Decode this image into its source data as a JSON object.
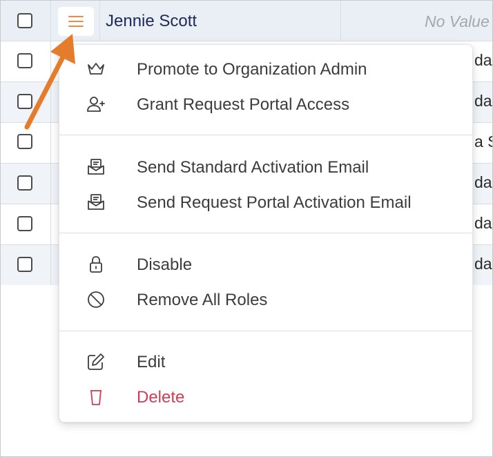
{
  "table": {
    "header_row": {
      "name": "Jennie Scott",
      "value": "No Value"
    },
    "rows": [
      {
        "role_fragment": "da"
      },
      {
        "role_fragment": "dar"
      },
      {
        "role_fragment": "a S"
      },
      {
        "role_fragment": "da"
      },
      {
        "role_fragment": "da"
      },
      {
        "role_fragment": "da"
      }
    ]
  },
  "menu": {
    "groups": [
      [
        {
          "label": "Promote to Organization Admin",
          "icon": "crown-icon"
        },
        {
          "label": "Grant Request Portal Access",
          "icon": "user-plus-icon"
        }
      ],
      [
        {
          "label": "Send Standard Activation Email",
          "icon": "mail-open-icon"
        },
        {
          "label": "Send Request Portal Activation Email",
          "icon": "mail-open-icon"
        }
      ],
      [
        {
          "label": "Disable",
          "icon": "lock-icon"
        },
        {
          "label": "Remove All Roles",
          "icon": "ban-icon"
        }
      ],
      [
        {
          "label": "Edit",
          "icon": "edit-icon"
        },
        {
          "label": "Delete",
          "icon": "trash-icon"
        }
      ]
    ]
  },
  "colors": {
    "accent_orange": "#f08a3c",
    "danger_red": "#d23c52",
    "name_text": "#202a5a"
  },
  "annotation": {
    "icon": "arrow-annotation-icon"
  }
}
